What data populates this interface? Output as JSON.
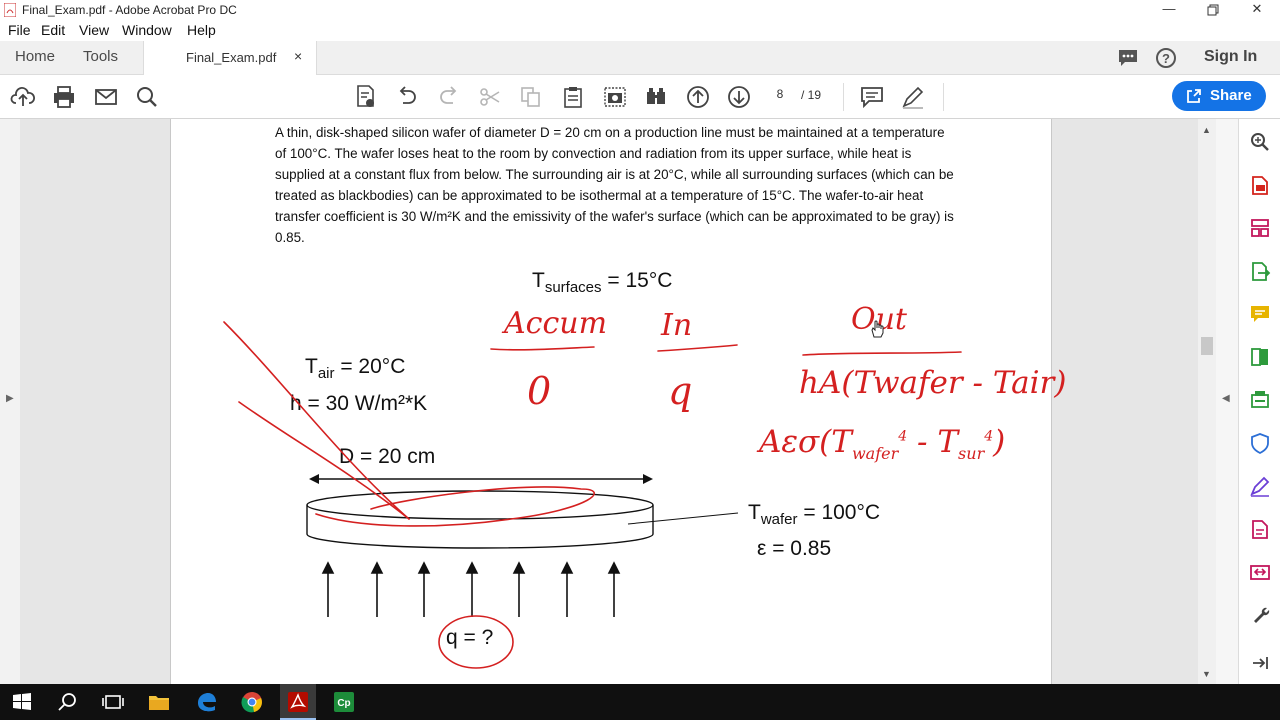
{
  "window": {
    "title": "Final_Exam.pdf - Adobe Acrobat Pro DC",
    "min_icon": "minimize-icon",
    "max_icon": "restore-icon",
    "close_icon": "close-icon"
  },
  "menu": [
    "File",
    "Edit",
    "View",
    "Window",
    "Help"
  ],
  "tabs": {
    "home": "Home",
    "tools": "Tools",
    "document": "Final_Exam.pdf",
    "close_glyph": "×"
  },
  "header_right": {
    "signin": "Sign In"
  },
  "toolbar": {
    "page_current": "8",
    "page_total": "/ 19",
    "share": "Share"
  },
  "document": {
    "problem_text": "A thin, disk-shaped silicon wafer of diameter D = 20 cm on a production line must be maintained at a temperature of 100°C. The wafer loses heat to the room by convection and radiation from its upper surface, while heat is supplied at a constant flux from below. The surrounding air is at 20°C, while all surrounding surfaces (which can be treated as blackbodies) can be approximated to be isothermal at a temperature of 15°C. The wafer-to-air heat transfer coefficient is 30 W/m²K and the emissivity of the wafer's surface (which can be approximated to be gray) is 0.85.",
    "t_surfaces_sym": "T",
    "t_surfaces_sub": "surfaces",
    "t_surfaces_val": " = 15°C",
    "t_air_sym": "T",
    "t_air_sub": "air",
    "t_air_val": " = 20°C",
    "h_text": "h = 30 W/m²*K",
    "d_text": "D = 20 cm",
    "t_wafer_sym": "T",
    "t_wafer_sub": "wafer",
    "t_wafer_val": " = 100°C",
    "eps_text": "ε = 0.85",
    "q_text": "q = ?"
  },
  "annotations": {
    "accum": "Accum",
    "in": "In",
    "out": "Out",
    "zero": "0",
    "q": "q",
    "conv": "hA(Twafer - Tair)",
    "rad_prefix": "Aεσ(",
    "rad_t1": "T",
    "rad_t1_sub": "wafer",
    "rad_minus": " - ",
    "rad_t2": "T",
    "rad_t2_sub": "sur",
    "rad_close": ")",
    "exp4a": "4",
    "exp4b": "4"
  },
  "colors": {
    "ink": "#d42020",
    "accent": "#1473e6",
    "acrobat_red": "#d4241c",
    "panel_icon_magenta": "#c3175d",
    "panel_icon_green": "#2d9a3c",
    "panel_icon_blue": "#2c6fd6",
    "panel_icon_yellow": "#e7b400"
  }
}
